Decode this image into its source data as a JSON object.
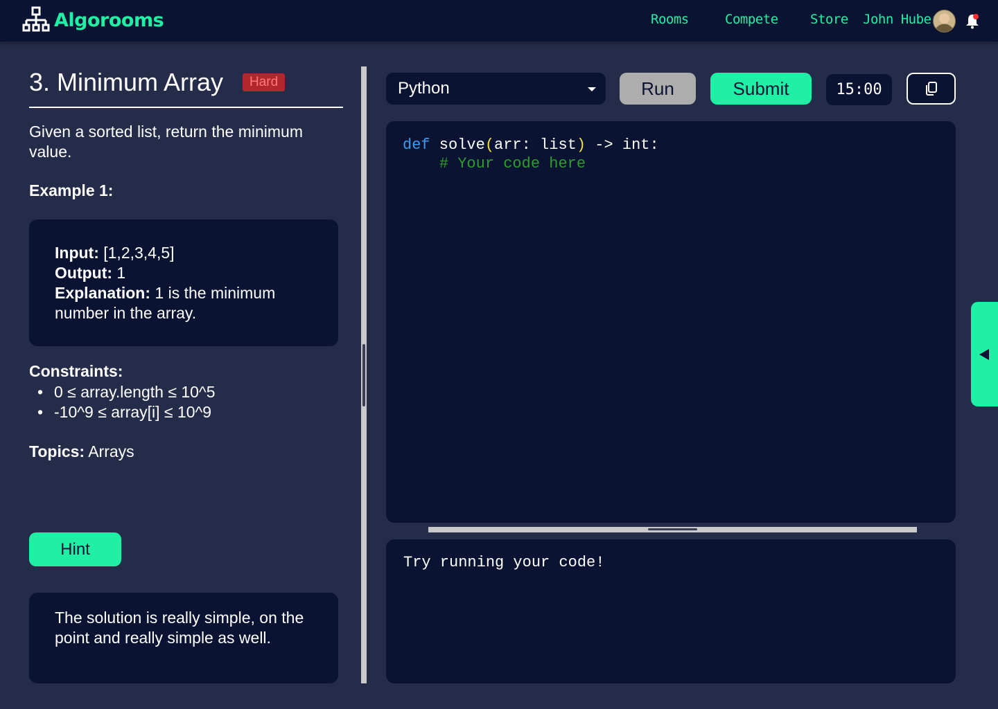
{
  "header": {
    "brand": "Algorooms",
    "nav": {
      "rooms": "Rooms",
      "compete": "Compete",
      "store": "Store"
    },
    "user_name": "John Huber",
    "icons": [
      "network-logo-icon",
      "avatar",
      "bell-icon"
    ]
  },
  "problem": {
    "title": "3. Minimum Array",
    "difficulty": "Hard",
    "description": "Given a sorted list, return the minimum value.",
    "example_heading": "Example 1:",
    "example": {
      "input_label": "Input:",
      "input_value": " [1,2,3,4,5]",
      "output_label": "Output:",
      "output_value": " 1",
      "explanation_label": "Explanation:",
      "explanation_value": " 1 is the minimum number in the array."
    },
    "constraints_heading": "Constraints:",
    "constraints": [
      "0 ≤ array.length ≤ 10^5",
      "-10^9 ≤ array[i] ≤ 10^9"
    ],
    "topics_label": "Topics:",
    "topics_value": " Arrays",
    "hint_button": "Hint",
    "hint_text": "The solution is really simple, on the point and really simple as well."
  },
  "editor": {
    "language": "Python",
    "run_label": "Run",
    "submit_label": "Submit",
    "timer": "15:00",
    "code": {
      "kw": "def",
      "sig_a": " solve",
      "paren_open": "(",
      "args": "arr: list",
      "paren_close": ")",
      "sig_b": " -> int:",
      "indent": "    ",
      "comment": "# Your code here"
    },
    "output_text": "Try running your code!"
  },
  "colors": {
    "background": "#252c4a",
    "panel": "#0a1332",
    "accent": "#1ff0a5",
    "hard_badge": "#b3262e",
    "keyword": "#3a9cf0",
    "comment": "#2e9d2e",
    "paren": "#f0e040"
  }
}
